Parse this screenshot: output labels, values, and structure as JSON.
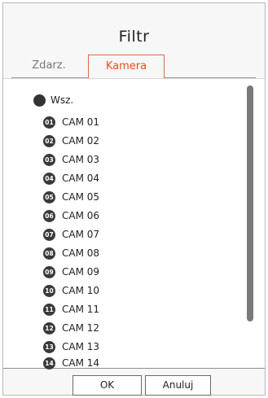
{
  "dialog": {
    "title": "Filtr"
  },
  "tabs": [
    {
      "label": "Zdarz.",
      "active": false
    },
    {
      "label": "Kamera",
      "active": true
    }
  ],
  "list": {
    "all_label": "Wsz.",
    "cameras": [
      {
        "badge": "01",
        "label": "CAM 01"
      },
      {
        "badge": "02",
        "label": "CAM 02"
      },
      {
        "badge": "03",
        "label": "CAM 03"
      },
      {
        "badge": "04",
        "label": "CAM 04"
      },
      {
        "badge": "05",
        "label": "CAM 05"
      },
      {
        "badge": "06",
        "label": "CAM 06"
      },
      {
        "badge": "07",
        "label": "CAM 07"
      },
      {
        "badge": "08",
        "label": "CAM 08"
      },
      {
        "badge": "09",
        "label": "CAM 09"
      },
      {
        "badge": "10",
        "label": "CAM 10"
      },
      {
        "badge": "11",
        "label": "CAM 11"
      },
      {
        "badge": "12",
        "label": "CAM 12"
      },
      {
        "badge": "13",
        "label": "CAM 13"
      },
      {
        "badge": "14",
        "label": "CAM 14"
      }
    ]
  },
  "buttons": {
    "ok_label": "OK",
    "cancel_label": "Anuluj"
  },
  "colors": {
    "active_tab_text": "#e84b1c",
    "active_tab_border": "#e2693e",
    "badge_fill": "#3a3a3a",
    "scrollbar": "#7a7a7a"
  }
}
